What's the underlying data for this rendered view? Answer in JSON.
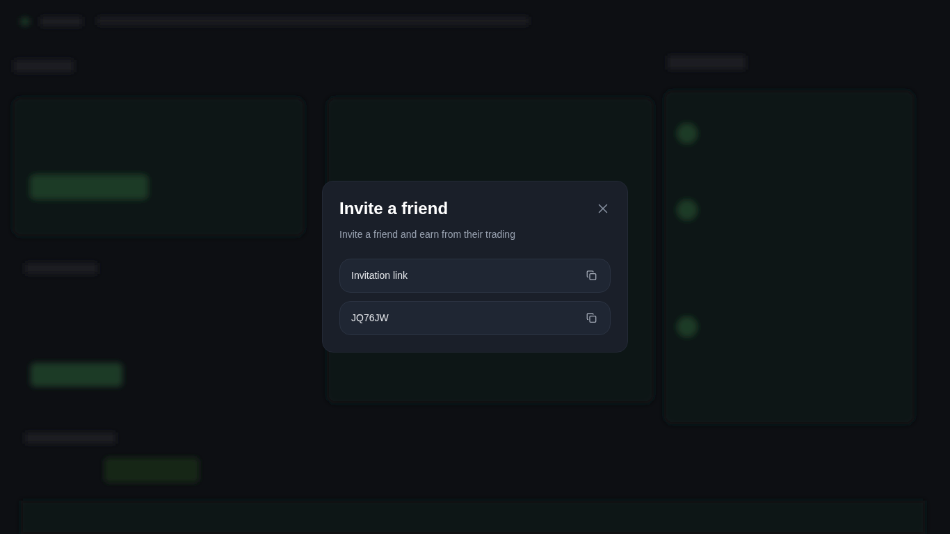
{
  "dialog": {
    "title": "Invite a friend",
    "subtitle": "Invite a friend and earn from their trading",
    "fields": [
      {
        "value": "Invitation link"
      },
      {
        "value": "JQ76JW"
      }
    ]
  }
}
